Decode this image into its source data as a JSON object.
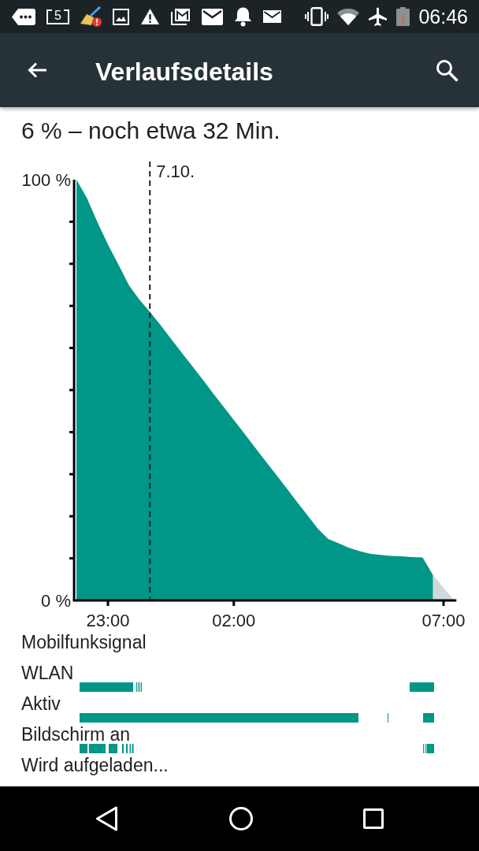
{
  "status_bar": {
    "icon_number": "5",
    "time": "06:46"
  },
  "app_bar": {
    "title": "Verlaufsdetails"
  },
  "summary": "6 % – noch etwa 32 Min.",
  "chart": {
    "chart_data": {
      "type": "area",
      "categories": [
        null,
        null,
        null,
        "23:00",
        null,
        null,
        null,
        null,
        null,
        null,
        null,
        null,
        null,
        null,
        null,
        "02:00",
        null,
        null,
        null,
        null,
        null,
        null,
        null,
        null,
        null,
        null,
        null,
        null,
        null,
        null,
        null,
        null,
        null,
        null,
        null,
        "07:00",
        null
      ],
      "series": [
        {
          "color": "#009688",
          "values": [
            100,
            95.6,
            89.9,
            84.6,
            79.8,
            74.9,
            71.5,
            68.6,
            65.5,
            62.2,
            59.0,
            55.8,
            52.6,
            49.3,
            46.1,
            42.9,
            39.7,
            36.4,
            33.2,
            30.0,
            26.8,
            23.5,
            20.3,
            17.1,
            14.6,
            13.6,
            12.5,
            11.7,
            11.1,
            10.8,
            10.6,
            10.5,
            10.3,
            10.2,
            6,
            null,
            null
          ]
        },
        {
          "color": "#cfd8dc",
          "values": [
            null,
            null,
            null,
            null,
            null,
            null,
            null,
            null,
            null,
            null,
            null,
            null,
            null,
            null,
            null,
            null,
            null,
            null,
            null,
            null,
            null,
            null,
            null,
            null,
            null,
            null,
            null,
            null,
            null,
            null,
            null,
            null,
            null,
            null,
            6,
            3,
            0
          ]
        }
      ],
      "ylim": [
        0,
        100
      ],
      "yticks": [
        {
          "value": 0,
          "label": "0 %"
        },
        {
          "value": 100,
          "label": "100 %"
        }
      ],
      "annotations": [
        "7.10."
      ]
    }
  },
  "activity_rows": [
    {
      "label": "Mobilfunksignal"
    },
    {
      "label": "WLAN"
    },
    {
      "label": "Aktiv"
    },
    {
      "label": "Bildschirm an"
    },
    {
      "label": "Wird aufgeladen..."
    }
  ]
}
